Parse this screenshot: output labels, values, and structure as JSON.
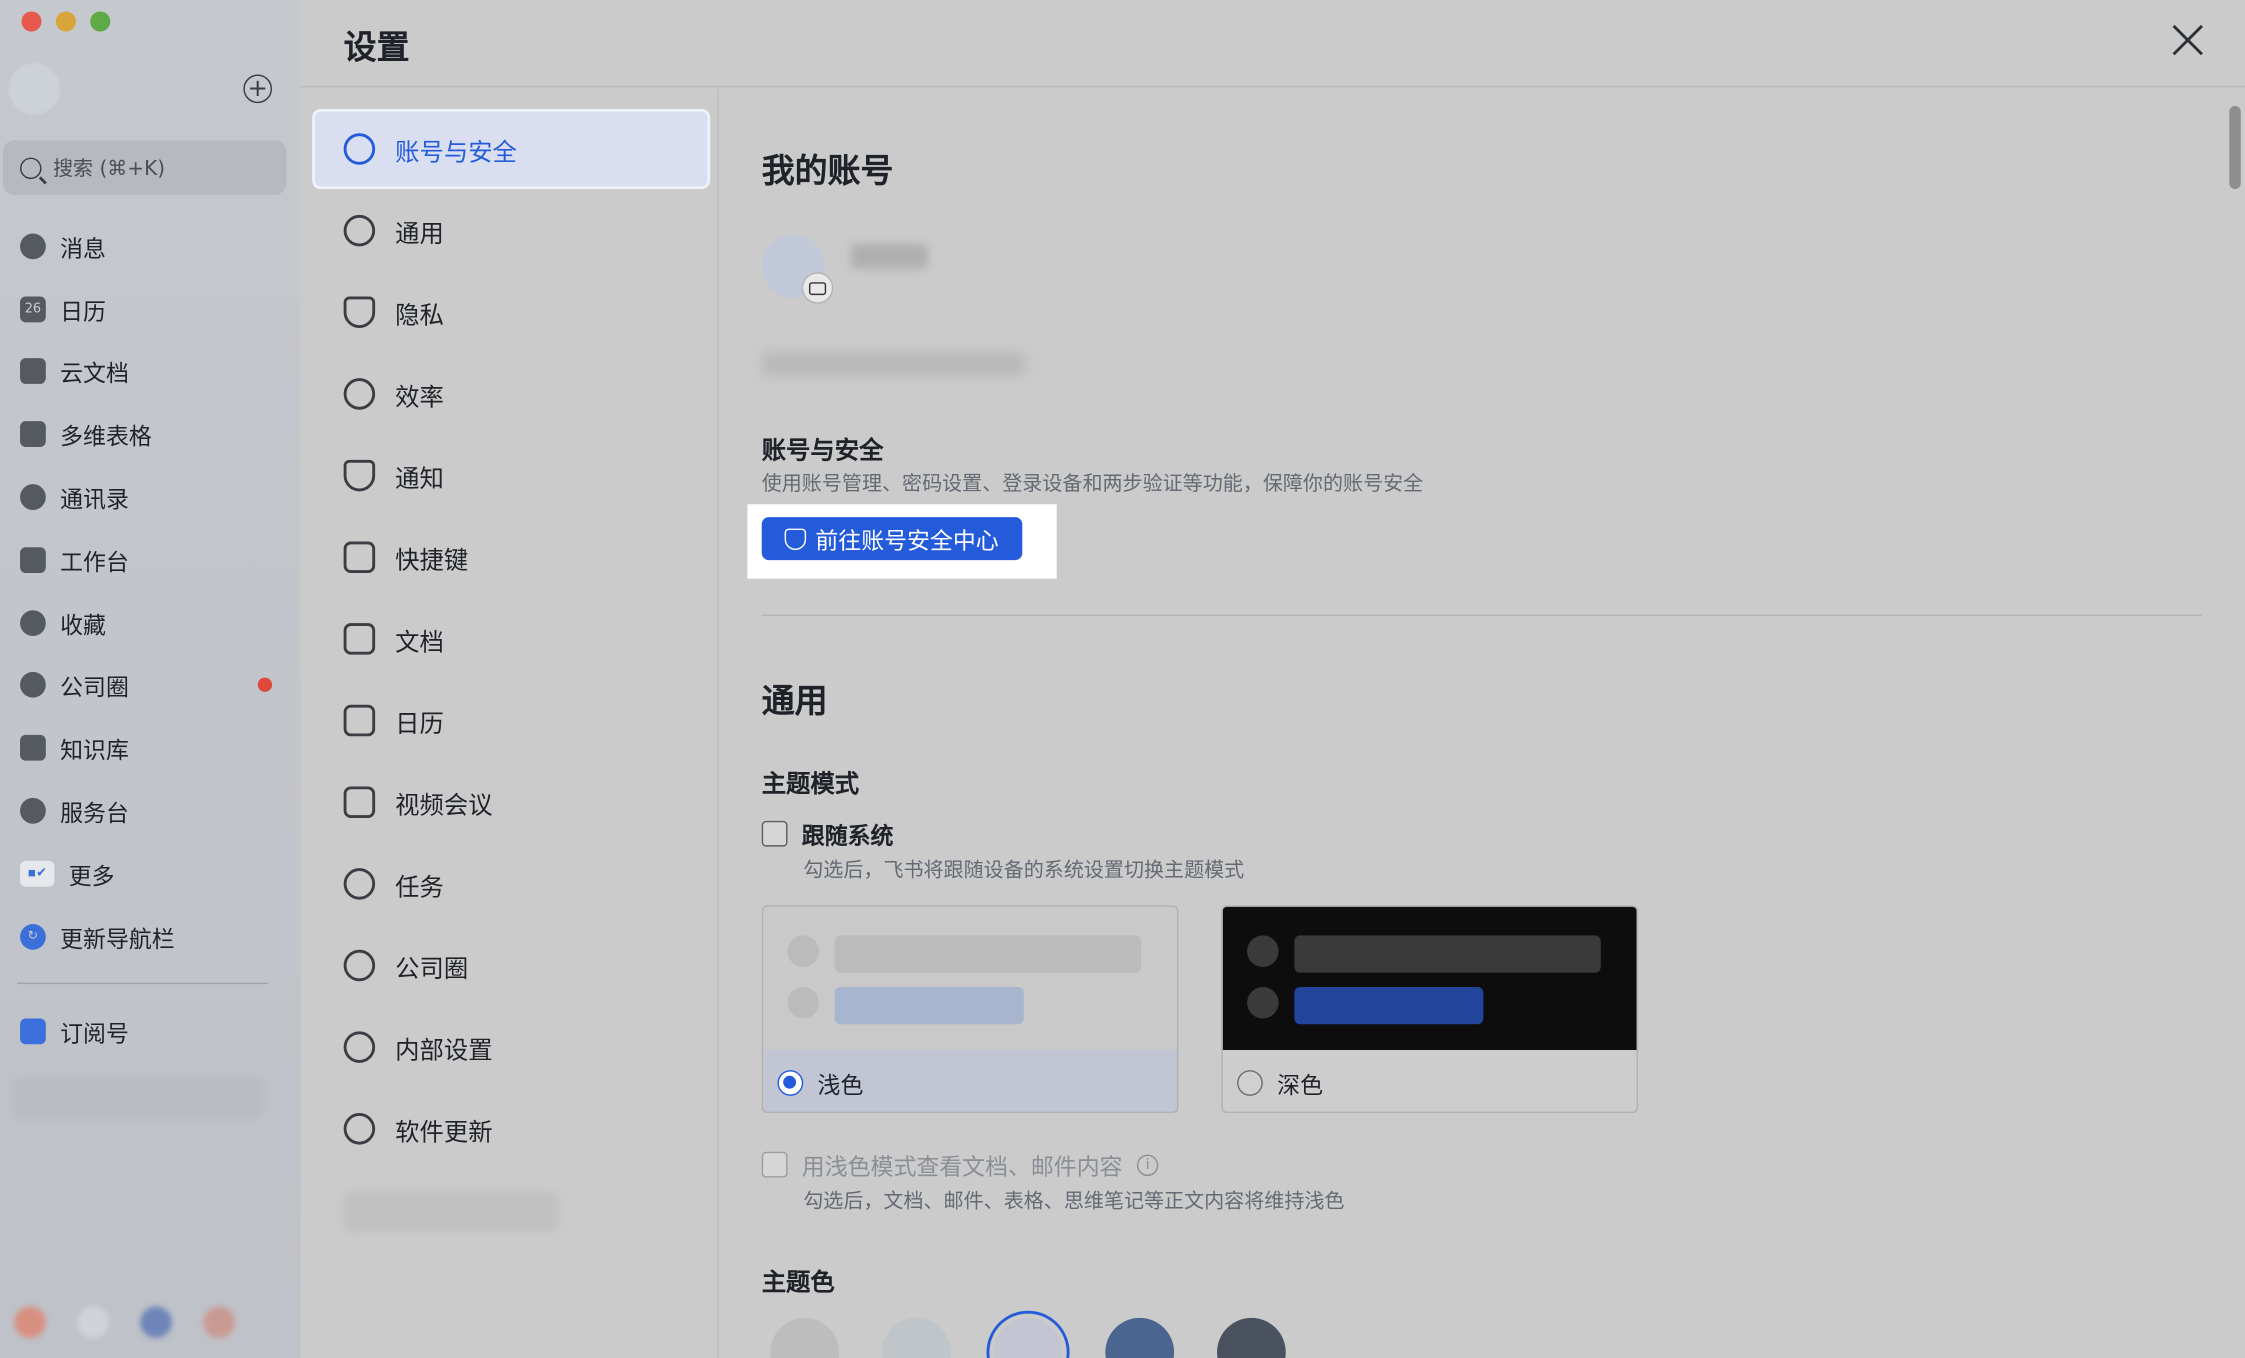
{
  "sidebar": {
    "search_placeholder": "搜索 (⌘+K)",
    "items": [
      {
        "label": "消息",
        "icon": "chat-icon"
      },
      {
        "label": "日历",
        "icon": "calendar-icon",
        "badge_text": "26"
      },
      {
        "label": "云文档",
        "icon": "docs-icon"
      },
      {
        "label": "多维表格",
        "icon": "table-icon"
      },
      {
        "label": "通讯录",
        "icon": "contacts-icon"
      },
      {
        "label": "工作台",
        "icon": "workplace-icon"
      },
      {
        "label": "收藏",
        "icon": "star-icon"
      },
      {
        "label": "公司圈",
        "icon": "moments-icon",
        "has_red_dot": true
      },
      {
        "label": "知识库",
        "icon": "wiki-icon"
      },
      {
        "label": "服务台",
        "icon": "headset-icon"
      },
      {
        "label": "更多",
        "icon": "more-apps-icon"
      },
      {
        "label": "更新导航栏",
        "icon": "refresh-icon"
      }
    ],
    "subscription_label": "订阅号"
  },
  "modal": {
    "title": "设置",
    "nav": [
      {
        "label": "账号与安全",
        "icon": "user-icon",
        "active": true
      },
      {
        "label": "通用",
        "icon": "gear-icon"
      },
      {
        "label": "隐私",
        "icon": "shield-icon"
      },
      {
        "label": "效率",
        "icon": "bulb-icon"
      },
      {
        "label": "通知",
        "icon": "bell-icon"
      },
      {
        "label": "快捷键",
        "icon": "keyboard-icon"
      },
      {
        "label": "文档",
        "icon": "document-icon"
      },
      {
        "label": "日历",
        "icon": "calendar-icon"
      },
      {
        "label": "视频会议",
        "icon": "video-icon"
      },
      {
        "label": "任务",
        "icon": "task-icon"
      },
      {
        "label": "公司圈",
        "icon": "moments-icon"
      },
      {
        "label": "内部设置",
        "icon": "wrench-icon"
      },
      {
        "label": "软件更新",
        "icon": "upgrade-icon"
      }
    ]
  },
  "account": {
    "heading": "我的账号",
    "security_title": "账号与安全",
    "security_desc": "使用账号管理、密码设置、登录设备和两步验证等功能，保障你的账号安全",
    "security_button": "前往账号安全中心"
  },
  "general": {
    "heading": "通用",
    "theme_mode_title": "主题模式",
    "follow_system_label": "跟随系统",
    "follow_system_desc": "勾选后，飞书将跟随设备的系统设置切换主题模式",
    "light_label": "浅色",
    "dark_label": "深色",
    "selected_theme": "浅色",
    "light_docs_label": "用浅色模式查看文档、邮件内容",
    "light_docs_desc": "勾选后，文档、邮件、表格、思维笔记等正文内容将维持浅色",
    "theme_color_title": "主题色",
    "theme_colors": [
      "#bdbdbd",
      "#c0c5c9",
      "#c3c6d2",
      "#4a6590",
      "#4a5260"
    ],
    "selected_color_index": 2,
    "accent": "#245bdb"
  }
}
